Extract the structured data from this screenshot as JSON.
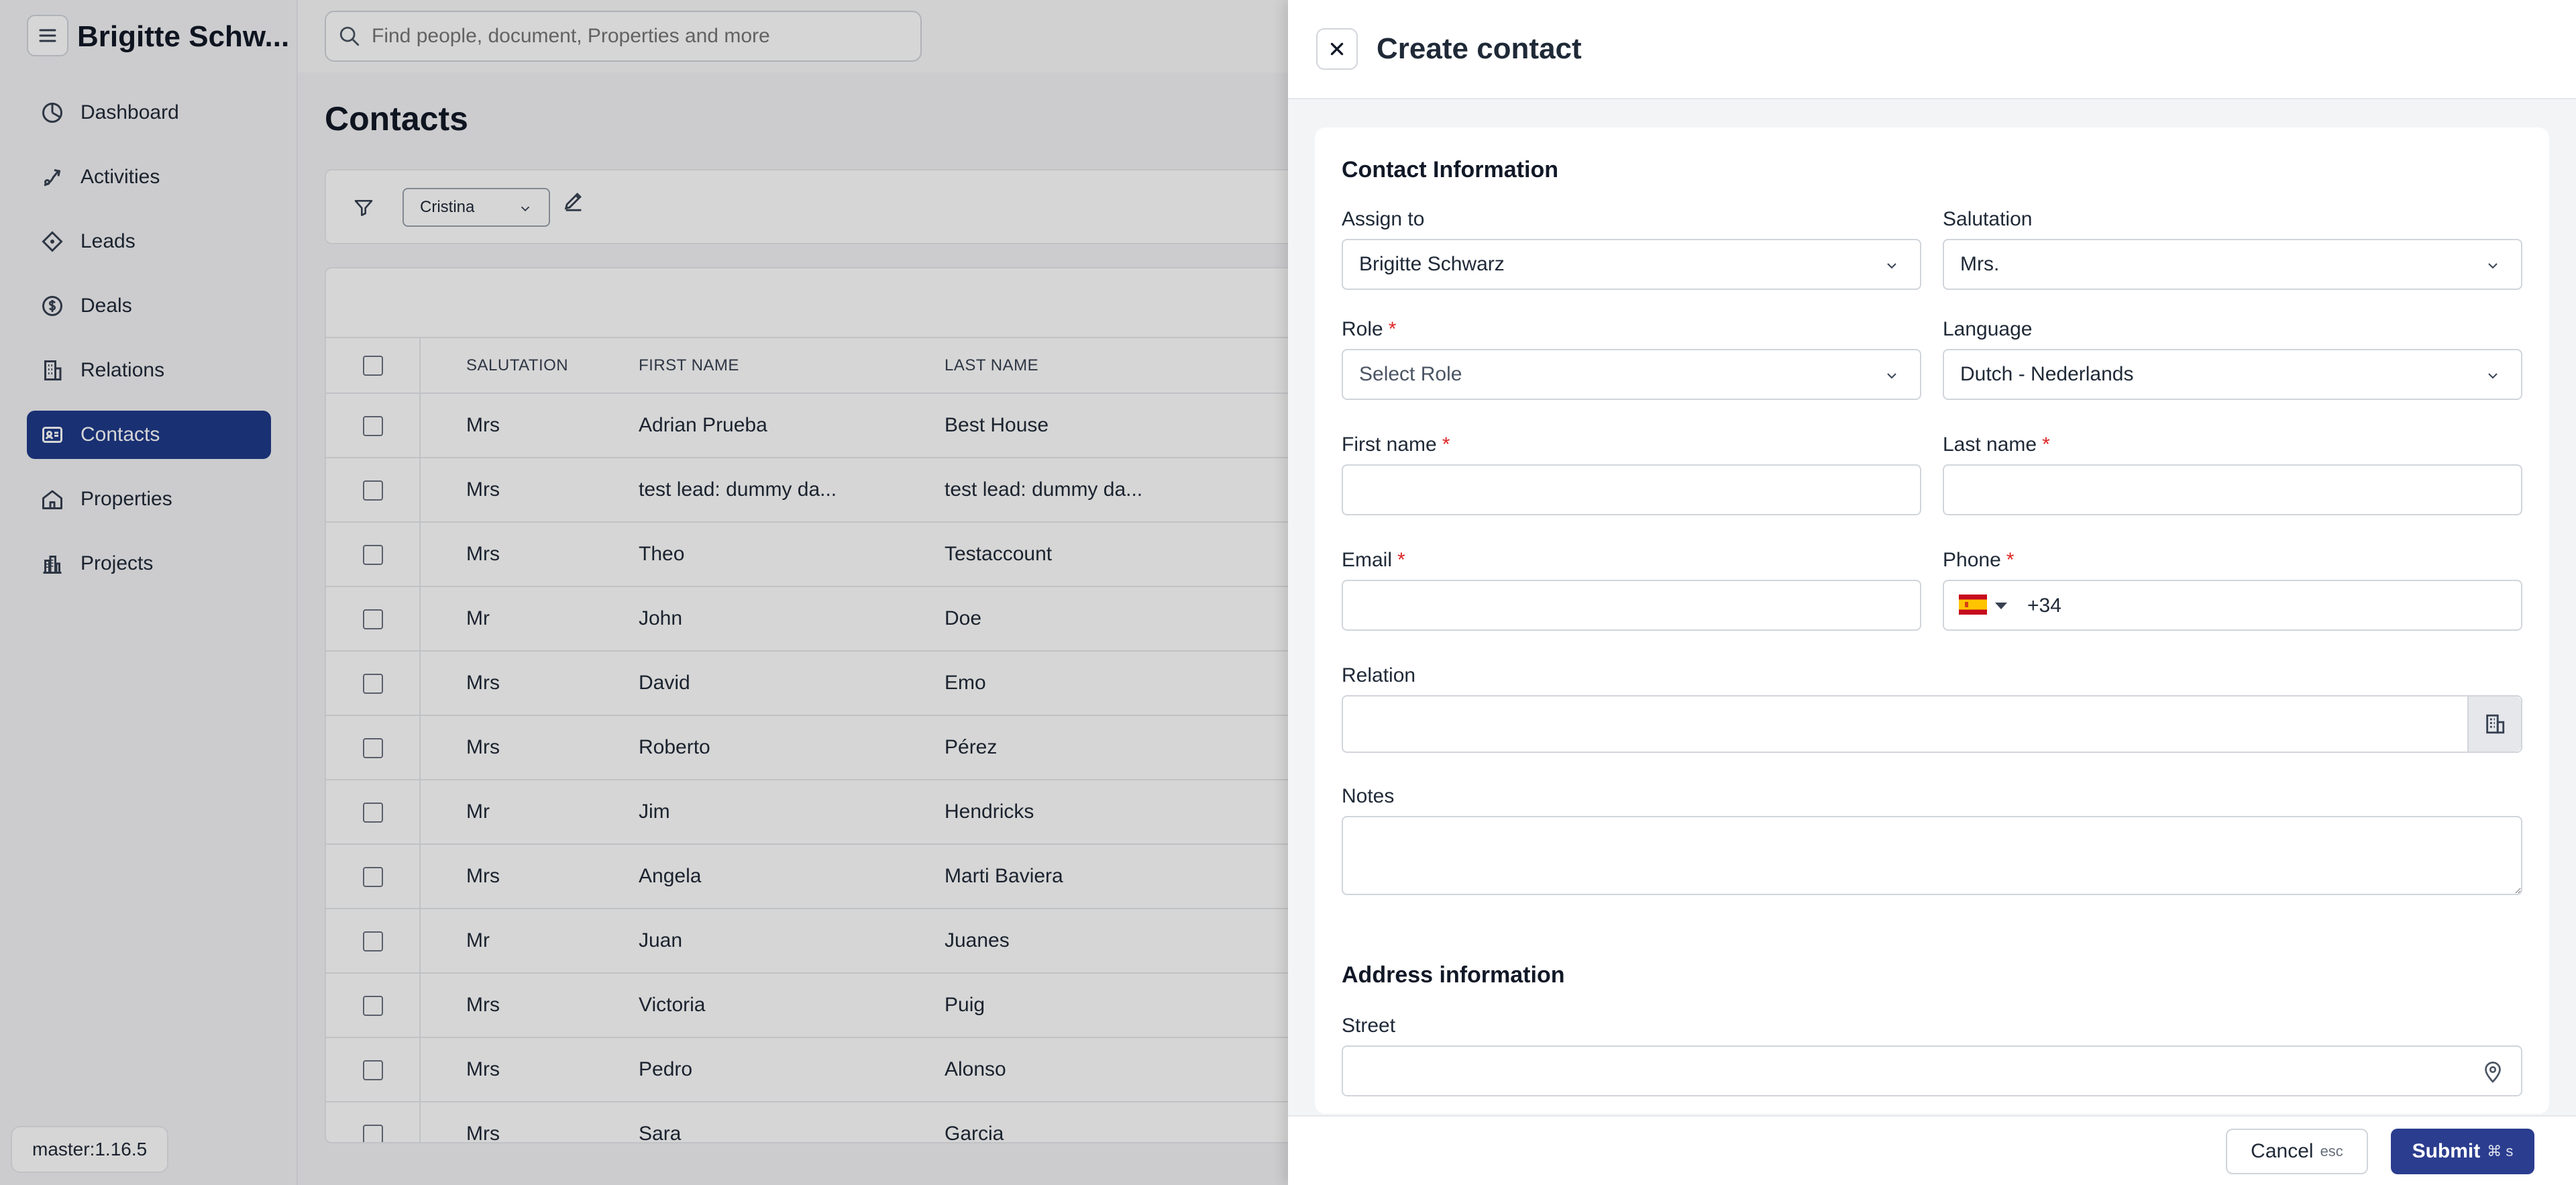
{
  "app": {
    "user_name": "Brigitte Schw...",
    "version": "master:1.16.5"
  },
  "sidebar": {
    "items": [
      {
        "label": "Dashboard",
        "icon": "dashboard-icon",
        "active": false
      },
      {
        "label": "Activities",
        "icon": "activities-icon",
        "active": false
      },
      {
        "label": "Leads",
        "icon": "leads-icon",
        "active": false
      },
      {
        "label": "Deals",
        "icon": "deals-icon",
        "active": false
      },
      {
        "label": "Relations",
        "icon": "relations-icon",
        "active": false
      },
      {
        "label": "Contacts",
        "icon": "contacts-icon",
        "active": true
      },
      {
        "label": "Properties",
        "icon": "properties-icon",
        "active": false
      },
      {
        "label": "Projects",
        "icon": "projects-icon",
        "active": false
      }
    ]
  },
  "search": {
    "placeholder": "Find people, document, Properties and more"
  },
  "page": {
    "title": "Contacts"
  },
  "filters": {
    "owner": "Cristina"
  },
  "table": {
    "columns": [
      "SALUTATION",
      "FIRST NAME",
      "LAST NAME"
    ],
    "rows": [
      {
        "salutation": "Mrs",
        "first": "Adrian Prueba",
        "last": "Best House"
      },
      {
        "salutation": "Mrs",
        "first": "test lead: dummy da...",
        "last": "test lead: dummy da..."
      },
      {
        "salutation": "Mrs",
        "first": "Theo",
        "last": "Testaccount"
      },
      {
        "salutation": "Mr",
        "first": "John",
        "last": "Doe"
      },
      {
        "salutation": "Mrs",
        "first": "David",
        "last": "Emo"
      },
      {
        "salutation": "Mrs",
        "first": "Roberto",
        "last": "Pérez"
      },
      {
        "salutation": "Mr",
        "first": "Jim",
        "last": "Hendricks"
      },
      {
        "salutation": "Mrs",
        "first": "Angela",
        "last": "Marti Baviera"
      },
      {
        "salutation": "Mr",
        "first": "Juan",
        "last": "Juanes"
      },
      {
        "salutation": "Mrs",
        "first": "Victoria",
        "last": "Puig"
      },
      {
        "salutation": "Mrs",
        "first": "Pedro",
        "last": "Alonso"
      },
      {
        "salutation": "Mrs",
        "first": "Sara",
        "last": "Garcia"
      }
    ]
  },
  "drawer": {
    "title": "Create contact",
    "contact_section": "Contact Information",
    "assign_to": {
      "label": "Assign to",
      "value": "Brigitte Schwarz"
    },
    "salutation": {
      "label": "Salutation",
      "value": "Mrs."
    },
    "role": {
      "label": "Role",
      "placeholder": "Select Role"
    },
    "language": {
      "label": "Language",
      "value": "Dutch - Nederlands"
    },
    "first_name": {
      "label": "First name",
      "value": ""
    },
    "last_name": {
      "label": "Last name",
      "value": ""
    },
    "email": {
      "label": "Email",
      "value": ""
    },
    "phone": {
      "label": "Phone",
      "code": "+34",
      "country": "ES"
    },
    "relation": {
      "label": "Relation",
      "value": ""
    },
    "notes": {
      "label": "Notes",
      "value": ""
    },
    "address_section": "Address information",
    "street": {
      "label": "Street",
      "value": ""
    },
    "required_mark": "*",
    "cancel": {
      "label": "Cancel",
      "shortcut": "esc"
    },
    "submit": {
      "label": "Submit",
      "shortcut": "⌘ s"
    }
  },
  "colors": {
    "accent": "#1e3a8a",
    "submit": "#2b3d8f",
    "required": "#dc2626"
  }
}
